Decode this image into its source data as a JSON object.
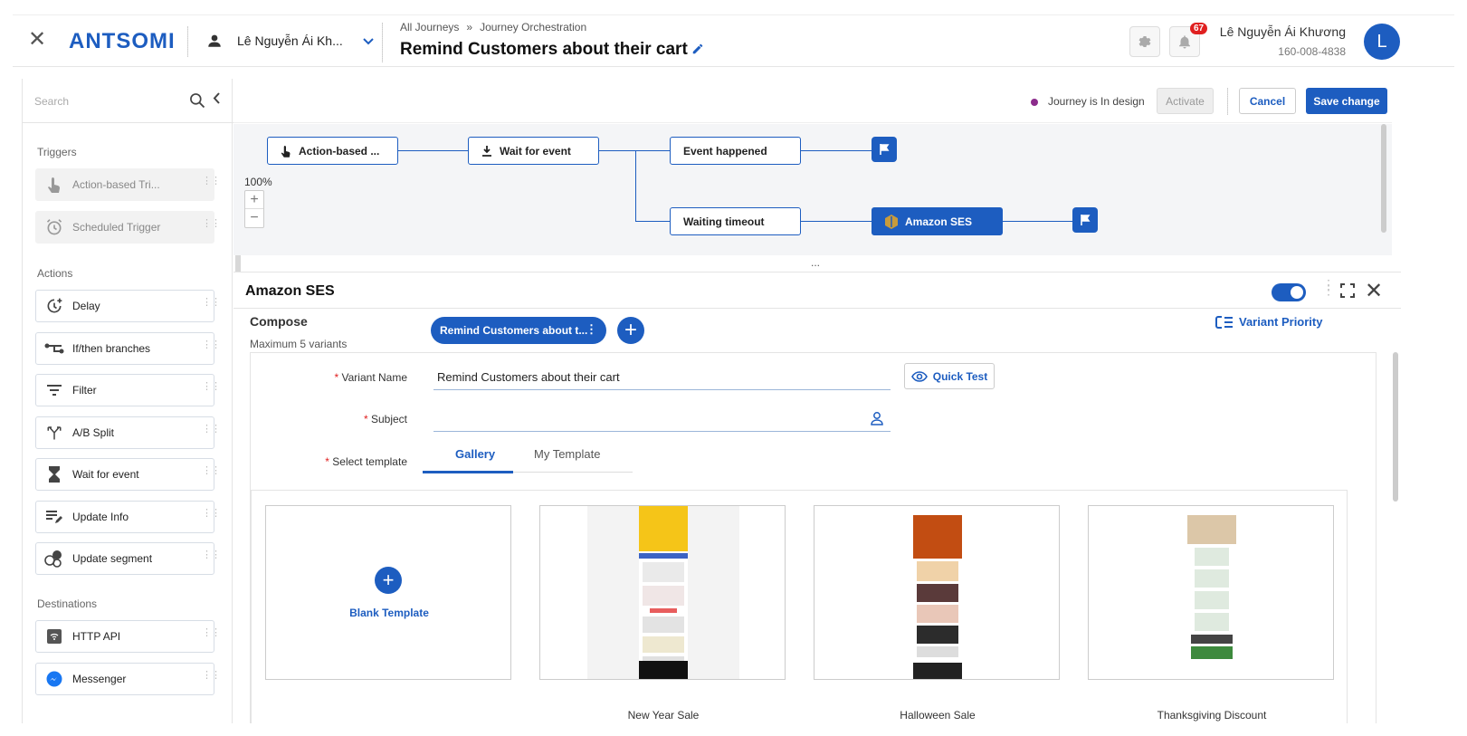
{
  "header": {
    "logo": "ANTSOMI",
    "account_name": "Lê Nguyễn Ái Kh...",
    "breadcrumb": [
      "All Journeys",
      "Journey Orchestration"
    ],
    "breadcrumb_sep": "»",
    "title": "Remind Customers about their cart",
    "notification_count": "67",
    "user_name": "Lê Nguyễn Ái Khương",
    "user_id": "160-008-4838",
    "avatar_letter": "L"
  },
  "sidebar": {
    "search_placeholder": "Search",
    "sections": {
      "triggers": "Triggers",
      "actions": "Actions",
      "destinations": "Destinations"
    },
    "triggers": [
      {
        "label": "Action-based Tri...",
        "icon": "touch-icon"
      },
      {
        "label": "Scheduled Trigger",
        "icon": "alarm-icon"
      }
    ],
    "actions": [
      {
        "label": "Delay",
        "icon": "delay-icon"
      },
      {
        "label": "If/then branches",
        "icon": "branch-icon"
      },
      {
        "label": "Filter",
        "icon": "filter-icon"
      },
      {
        "label": "A/B Split",
        "icon": "split-icon"
      },
      {
        "label": "Wait for event",
        "icon": "hourglass-icon"
      },
      {
        "label": "Update Info",
        "icon": "edit-list-icon"
      },
      {
        "label": "Update segment",
        "icon": "segment-icon"
      }
    ],
    "destinations": [
      {
        "label": "HTTP API",
        "icon": "api-icon"
      },
      {
        "label": "Messenger",
        "icon": "messenger-icon"
      }
    ]
  },
  "toolbar": {
    "status": "Journey is In design",
    "activate": "Activate",
    "cancel": "Cancel",
    "save": "Save change"
  },
  "canvas": {
    "zoom": "100%",
    "zoom_in": "+",
    "zoom_out": "−",
    "nodes": {
      "trigger": "Action-based ...",
      "wait": "Wait for event",
      "event": "Event happened",
      "timeout": "Waiting timeout",
      "ses": "Amazon SES"
    },
    "divider": "..."
  },
  "panel": {
    "title": "Amazon SES",
    "compose": "Compose",
    "max_variants": "Maximum 5 variants",
    "variant_pill": "Remind Customers about t...",
    "variant_priority": "Variant Priority",
    "fields": {
      "variant_name_label": "Variant Name",
      "variant_name_value": "Remind Customers about their cart",
      "subject_label": "Subject",
      "template_label": "Select template",
      "required_mark": "*"
    },
    "quick_test": "Quick Test",
    "tabs": [
      "Gallery",
      "My Template"
    ],
    "templates": [
      {
        "name": "Blank Template"
      },
      {
        "name": "New Year Sale"
      },
      {
        "name": "Halloween Sale"
      },
      {
        "name": "Thanksgiving Discount"
      }
    ]
  },
  "colors": {
    "brand": "#1d5dc0",
    "status_dot": "#8c2c8c",
    "badge": "#e02020"
  }
}
